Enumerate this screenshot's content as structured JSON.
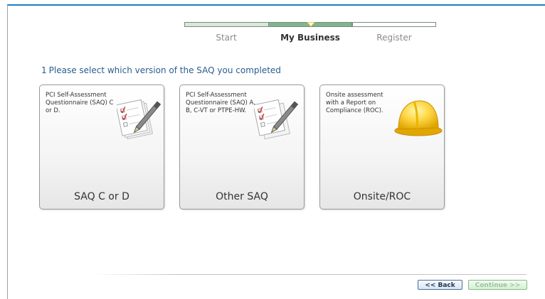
{
  "progress": {
    "steps": [
      {
        "label": "Start",
        "state": "done"
      },
      {
        "label": "My Business",
        "state": "current"
      },
      {
        "label": "Register",
        "state": "pending"
      }
    ]
  },
  "question": {
    "number": "1",
    "text": "Please select which version of the SAQ you completed"
  },
  "cards": [
    {
      "description": "PCI Self-Assessment Questionnaire (SAQ) C or D.",
      "title": "SAQ C or D",
      "icon": "checklist-pen-icon"
    },
    {
      "description": "PCI Self-Assessment Questionnaire (SAQ) A, B, C-VT or PTPE-HW.",
      "title": "Other SAQ",
      "icon": "checklist-pen-icon"
    },
    {
      "description": "Onsite assessment with a Report on Compliance (ROC).",
      "title": "Onsite/ROC",
      "icon": "hard-hat-icon"
    }
  ],
  "buttons": {
    "back": "<< Back",
    "continue": "Continue >>"
  },
  "colors": {
    "accent_blue": "#1f7fc0",
    "step_done": "#d7e8da",
    "step_current": "#7fb68e",
    "question_text": "#2a5d8f"
  }
}
